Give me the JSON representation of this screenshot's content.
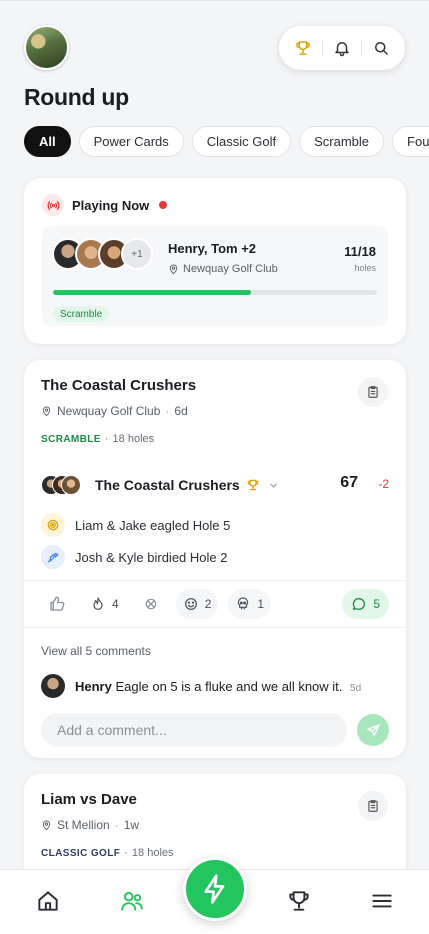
{
  "header": {
    "title": "Round up",
    "avatar_icon": "profile-avatar",
    "actions": [
      "trophy-icon",
      "bell-icon",
      "search-icon"
    ]
  },
  "filters": {
    "chips": [
      "All",
      "Power Cards",
      "Classic Golf",
      "Scramble",
      "Four"
    ],
    "selected": "All"
  },
  "playing_now": {
    "title": "Playing Now",
    "players": "Henry, Tom +2",
    "extra_count": "+1",
    "club": "Newquay Golf Club",
    "holes_played": "11/18",
    "holes_label": "holes",
    "progress": 0.61,
    "format": "Scramble"
  },
  "rounds": [
    {
      "title": "The Coastal Crushers",
      "club": "Newquay Golf Club",
      "age": "6d",
      "format": "SCRAMBLE",
      "holes": "18 holes",
      "team_name": "The Coastal Crushers",
      "score": "67",
      "diff": "-2",
      "events": [
        {
          "icon": "target-icon",
          "text": "Liam & Jake eagled Hole 5"
        },
        {
          "icon": "bird-icon",
          "text": "Josh & Kyle birdied Hole 2"
        }
      ],
      "reactions": {
        "fire": "4",
        "smile": "2",
        "skull": "1"
      },
      "comment_count": "5",
      "view_all": "View all 5 comments",
      "comment": {
        "user": "Henry",
        "text": "Eagle on 5 is a fluke and we all know it.",
        "time": "5d"
      },
      "comment_placeholder": "Add a comment..."
    },
    {
      "title": "Liam vs Dave",
      "club": "St Mellion",
      "age": "1w",
      "format": "CLASSIC GOLF",
      "holes": "18 holes"
    }
  ],
  "colors": {
    "accent": "#22c55e",
    "live": "#e53935",
    "navy": "#2f3c5a"
  },
  "nav": [
    "home-icon",
    "people-icon",
    "bolt-icon",
    "trophy-icon",
    "menu-icon"
  ]
}
